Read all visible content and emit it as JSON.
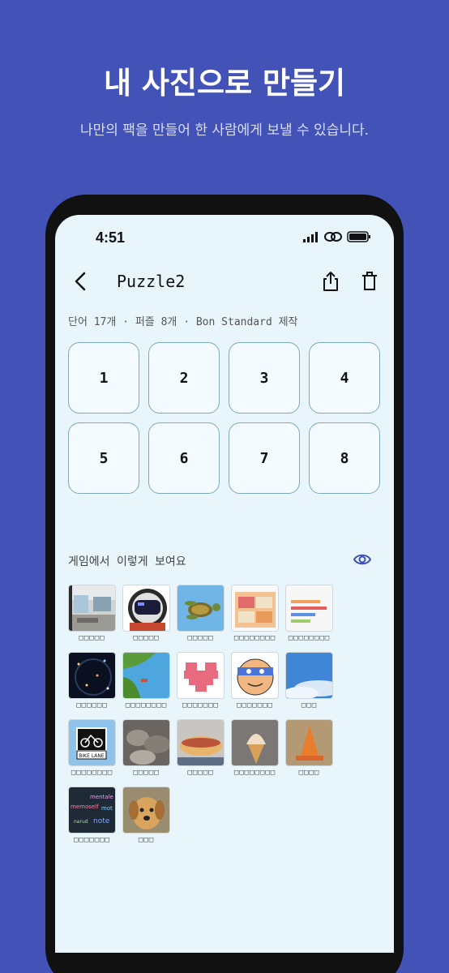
{
  "promo": {
    "title": "내 사진으로 만들기",
    "subtitle": "나만의 팩을 만들어 한 사람에게 보낼 수 있습니다."
  },
  "status_bar": {
    "time": "4:51",
    "icons": [
      "signal-icon",
      "link-icon",
      "battery-icon"
    ]
  },
  "header": {
    "title": "Puzzle2",
    "icons": [
      "back-icon",
      "share-icon",
      "trash-icon"
    ]
  },
  "meta": "단어 17개 · 퍼즐 8개 · Bon Standard 제작",
  "puzzles": [
    "1",
    "2",
    "3",
    "4",
    "5",
    "6",
    "7",
    "8"
  ],
  "preview": {
    "label": "게임에서 이렇게 보여요",
    "icon": "eye-icon",
    "rows": [
      [
        {
          "image": "office-room",
          "label": "□□□□□"
        },
        {
          "image": "pixel-astronaut",
          "label": "□□□□□"
        },
        {
          "image": "sea-turtle",
          "label": "□□□□□"
        },
        {
          "image": "app-screenshot-orange",
          "label": "□□□□□□□□"
        },
        {
          "image": "chart-screenshot",
          "label": "□□□□□□□□"
        }
      ],
      [
        {
          "image": "night-lights",
          "label": "□□□□□□"
        },
        {
          "image": "island-map",
          "label": "□□□□□□□□"
        },
        {
          "image": "pixel-heart",
          "label": "□□□□□□□"
        },
        {
          "image": "masked-face",
          "label": "□□□□□□□"
        },
        {
          "image": "blue-sky",
          "label": "□□□"
        }
      ],
      [
        {
          "image": "bike-lane-sign",
          "label": "□□□□□□□□"
        },
        {
          "image": "rocks",
          "label": "□□□□□"
        },
        {
          "image": "hot-dog",
          "label": "□□□□□"
        },
        {
          "image": "ice-cream",
          "label": "□□□□□□□□"
        },
        {
          "image": "traffic-cone",
          "label": "□□□□"
        }
      ],
      [
        {
          "image": "word-cloud",
          "label": "□□□□□□□"
        },
        {
          "image": "puppy",
          "label": "□□□"
        }
      ]
    ]
  },
  "image_texts": {
    "bike_sign": "BIKE LANE",
    "word_cloud": [
      "mentale",
      "memoself",
      "mot",
      "narud",
      "note"
    ]
  },
  "colors": {
    "background": "#4352b7",
    "screen": "#e8f6fc",
    "tile_border": "#7fa9b6",
    "eye_icon": "#3f4fb8"
  }
}
